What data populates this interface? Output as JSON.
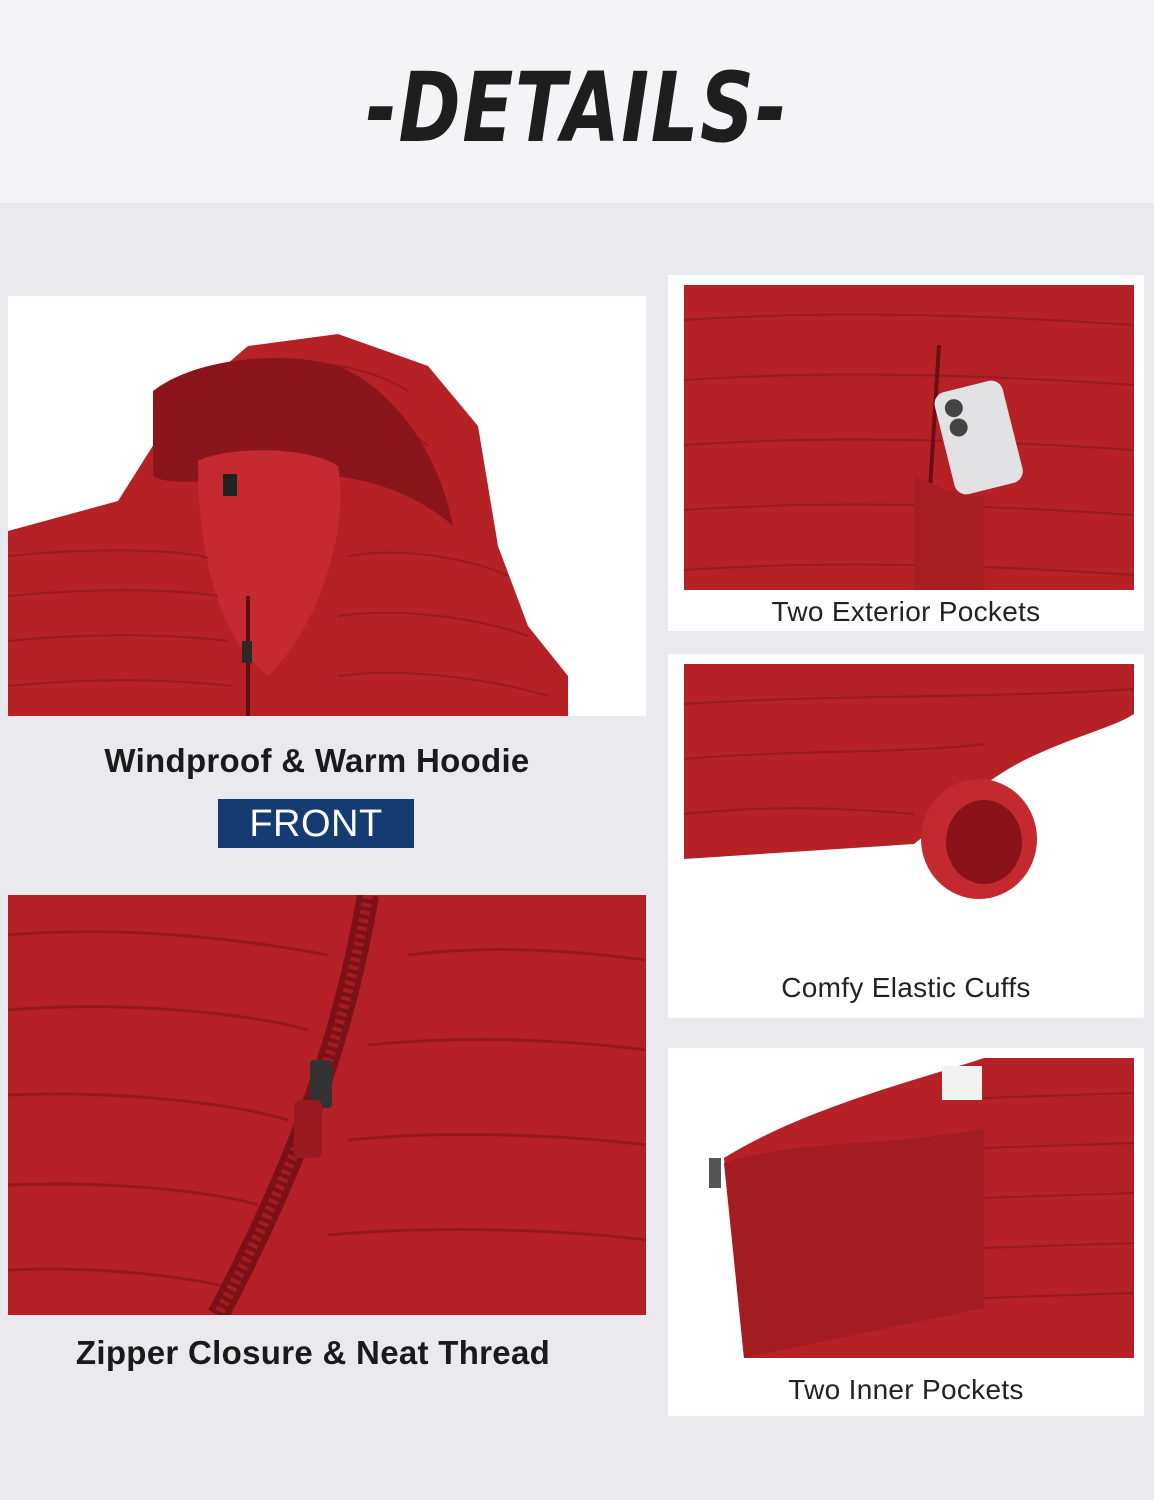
{
  "header": {
    "title": "-DETAILS-"
  },
  "features": {
    "hoodie": {
      "caption": "Windproof & Warm Hoodie",
      "badge": "FRONT"
    },
    "zipper": {
      "caption": "Zipper Closure & Neat Thread"
    },
    "exterior_pockets": {
      "caption": "Two Exterior Pockets"
    },
    "cuffs": {
      "caption": "Comfy Elastic Cuffs"
    },
    "inner_pockets": {
      "caption": "Two Inner Pockets"
    }
  },
  "colors": {
    "jacket_red": "#b31f25",
    "badge_navy": "#143c72",
    "background": "#e9e9ee"
  }
}
